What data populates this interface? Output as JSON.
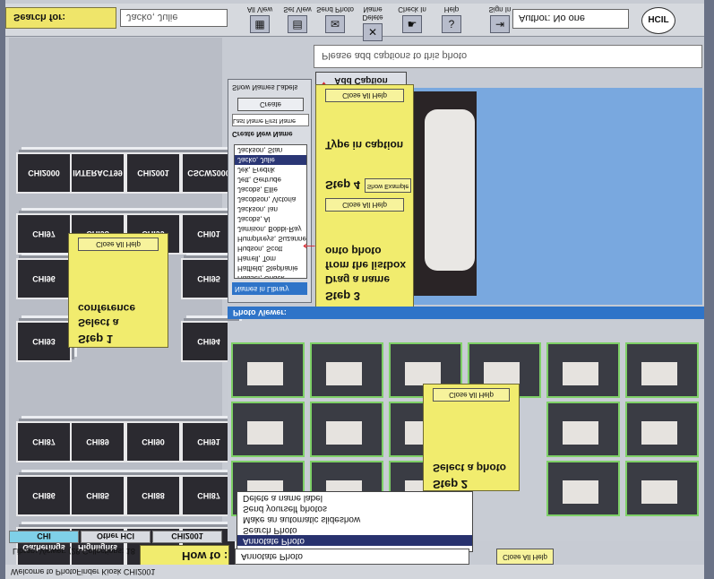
{
  "toolbar": {
    "search_label": "Search for:",
    "search_value": "Jacko, Julie",
    "buttons": [
      {
        "label": "All View",
        "glyph": "▦"
      },
      {
        "label": "Set View",
        "glyph": "▤"
      },
      {
        "label": "Send Photo",
        "glyph": "✉"
      },
      {
        "label": "Delete Name",
        "glyph": "✕"
      },
      {
        "label": "Check In",
        "glyph": "☛"
      },
      {
        "label": "Help",
        "glyph": "?"
      },
      {
        "label": "Sign In",
        "glyph": "⇥"
      }
    ],
    "author_value": "Author: No one",
    "logo_text": "HCIL"
  },
  "library": {
    "thumbs": [
      {
        "label": "CHI2000"
      },
      {
        "label": "INTERACT99"
      },
      {
        "label": "CHI2001"
      },
      {
        "label": "CSCW2000"
      },
      {
        "label": "CHI97"
      },
      {
        "label": "CHI98"
      },
      {
        "label": "CHI99"
      },
      {
        "label": "CHI01"
      },
      {
        "label": "CHI96"
      },
      {
        "label": "CHI95"
      },
      {
        "label": "CHI93"
      },
      {
        "label": "CHI94"
      },
      {
        "label": "CHI87"
      },
      {
        "label": "CHI89"
      },
      {
        "label": "CHI90"
      },
      {
        "label": "CHI91"
      },
      {
        "label": "CHI86"
      },
      {
        "label": "CHI85"
      },
      {
        "label": "CHI88"
      },
      {
        "label": "CHI87"
      },
      {
        "label": "Gatherings"
      },
      {
        "label": "Highlights"
      },
      {
        "label": "HFC83"
      },
      {
        "label": "CHI82"
      }
    ],
    "tabs": [
      "CHI",
      "Other HCI",
      "CHI2001"
    ],
    "status": "Library Viewer: (28 Collections: 18"
  },
  "steps": {
    "close_help": "Close All Help",
    "step1": [
      "Step 1",
      "Select a",
      "conference"
    ],
    "step2": [
      "Step 2",
      "Select a photo"
    ],
    "step3": [
      "Step 3",
      "Drag a name",
      "from the listbox",
      "onto photo"
    ],
    "step4": [
      "Step 4",
      "Type in caption"
    ],
    "show_example": "Show Example"
  },
  "names": {
    "header": "Names in Library",
    "create_label": "Create New Name",
    "name_fields": "Last Name First Name",
    "create_button": "Create",
    "show_labels": "Show Names Labels",
    "items": [
      "Hewlett, Eric",
      "Hauser, Chuck",
      "Hatfield, Stephanie",
      "Harrell, Tom",
      "Hudson, Scott",
      "Humphreys, Suzanne",
      "Jamison, Bobbi-Ray",
      "Jacobs, Al",
      "Jackson, Ian",
      "Jacobson, Victoria",
      "Jacobs, Ellie",
      "Jett, Gertrude",
      "Jek, Fredrik",
      "Jacko, Julie",
      "Jackson, Stan"
    ],
    "selected_index": 13
  },
  "caption": {
    "placeholder": "Please add captions to this photo",
    "add_button": "Add Caption"
  },
  "viewer": {
    "title": "Photo Viewer:"
  },
  "howto": {
    "label": "How to :",
    "selected": "Annotate Photo",
    "options": [
      "Delete a name label",
      "Send yourself photos",
      "Make an automatic slideshow",
      "Search Photo",
      "Annotate Photo"
    ],
    "highlight_index": 4
  },
  "window": {
    "title": "Welcome to PhotoFinder Kiosk CHI2001"
  }
}
